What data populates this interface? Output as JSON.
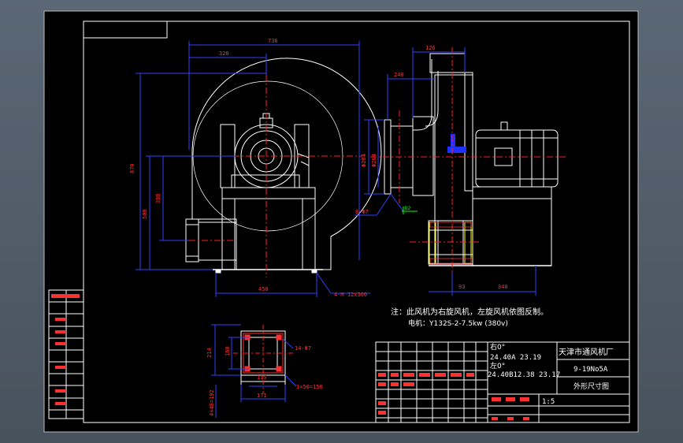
{
  "colors": {
    "background": "#000000",
    "frame": "#ffffff",
    "part": "#ffffff",
    "centerline": "#ff2020",
    "dimension": "#3040ff",
    "dim_text": "#ff3030",
    "leader": "#00ff00",
    "yellow": "#ffff00",
    "fill_blue": "#2030ff"
  },
  "dims": {
    "d736": "736",
    "d328": "328",
    "d870": "870",
    "d500": "500",
    "d388": "388",
    "d450": "450",
    "d126": "126",
    "d240": "240",
    "d_phi1": "Φ284",
    "d_phi2": "Φ264",
    "d_bolt": "8-Φ7",
    "d_mark": "D2",
    "d93": "93",
    "d340": "340",
    "d_base": "4-M 12x300",
    "d214": "214",
    "d160": "160",
    "d115": "115",
    "d171": "171",
    "d_holes": "14-Φ7",
    "d_pitch": "3×50=150",
    "d_side": "4×48=192"
  },
  "notes": {
    "line1": "注：此风机为右旋风机，左旋风机依图反制。",
    "line2": "电机：Y132S-2-7.5kw    (380v)"
  },
  "title_block": {
    "rot_right": "右0°",
    "row1": "24.40A   23.19",
    "rot_left": "左0°",
    "row2": "24.40B12.38 23.17",
    "company": "天津市通风机厂",
    "model": "9-19No5A",
    "drawing_name": "外形尺寸图",
    "scale": "1:5"
  }
}
